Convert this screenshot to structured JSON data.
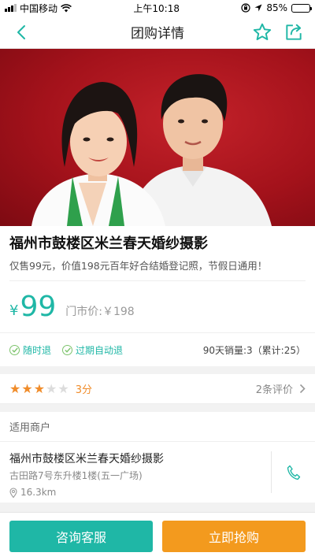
{
  "status_bar": {
    "carrier": "中国移动",
    "time": "上午10:18",
    "battery": "85%",
    "battery_level": 0.85
  },
  "nav": {
    "title": "团购详情",
    "back_icon": "chevron-left-icon",
    "favorite_icon": "star-outline-icon",
    "share_icon": "share-icon"
  },
  "hero": {
    "description_icon": "couple-photo-image"
  },
  "product": {
    "title": "福州市鼓楼区米兰春天婚纱摄影",
    "subtitle": "仅售99元，价值198元百年好合结婚登记照，节假日通用！"
  },
  "price": {
    "currency": "¥",
    "value": "99",
    "original": "门市价:￥198"
  },
  "tags": {
    "refund_anytime": "随时退",
    "refund_expired": "过期自动退",
    "sales": "90天销量:3（累计:25）"
  },
  "rating": {
    "stars_filled": 3,
    "stars_total": 5,
    "score": "3分",
    "reviews": "2条评价"
  },
  "shops": {
    "header": "适用商户",
    "items": [
      {
        "name": "福州市鼓楼区米兰春天婚纱摄影",
        "address": "古田路7号东升楼1楼(五一广场)",
        "distance": "16.3km"
      }
    ]
  },
  "actions": {
    "consult": "咨询客服",
    "buy": "立即抢购"
  },
  "colors": {
    "accent": "#1fb7a6",
    "buy": "#f39a1e",
    "star": "#f08c2a"
  }
}
